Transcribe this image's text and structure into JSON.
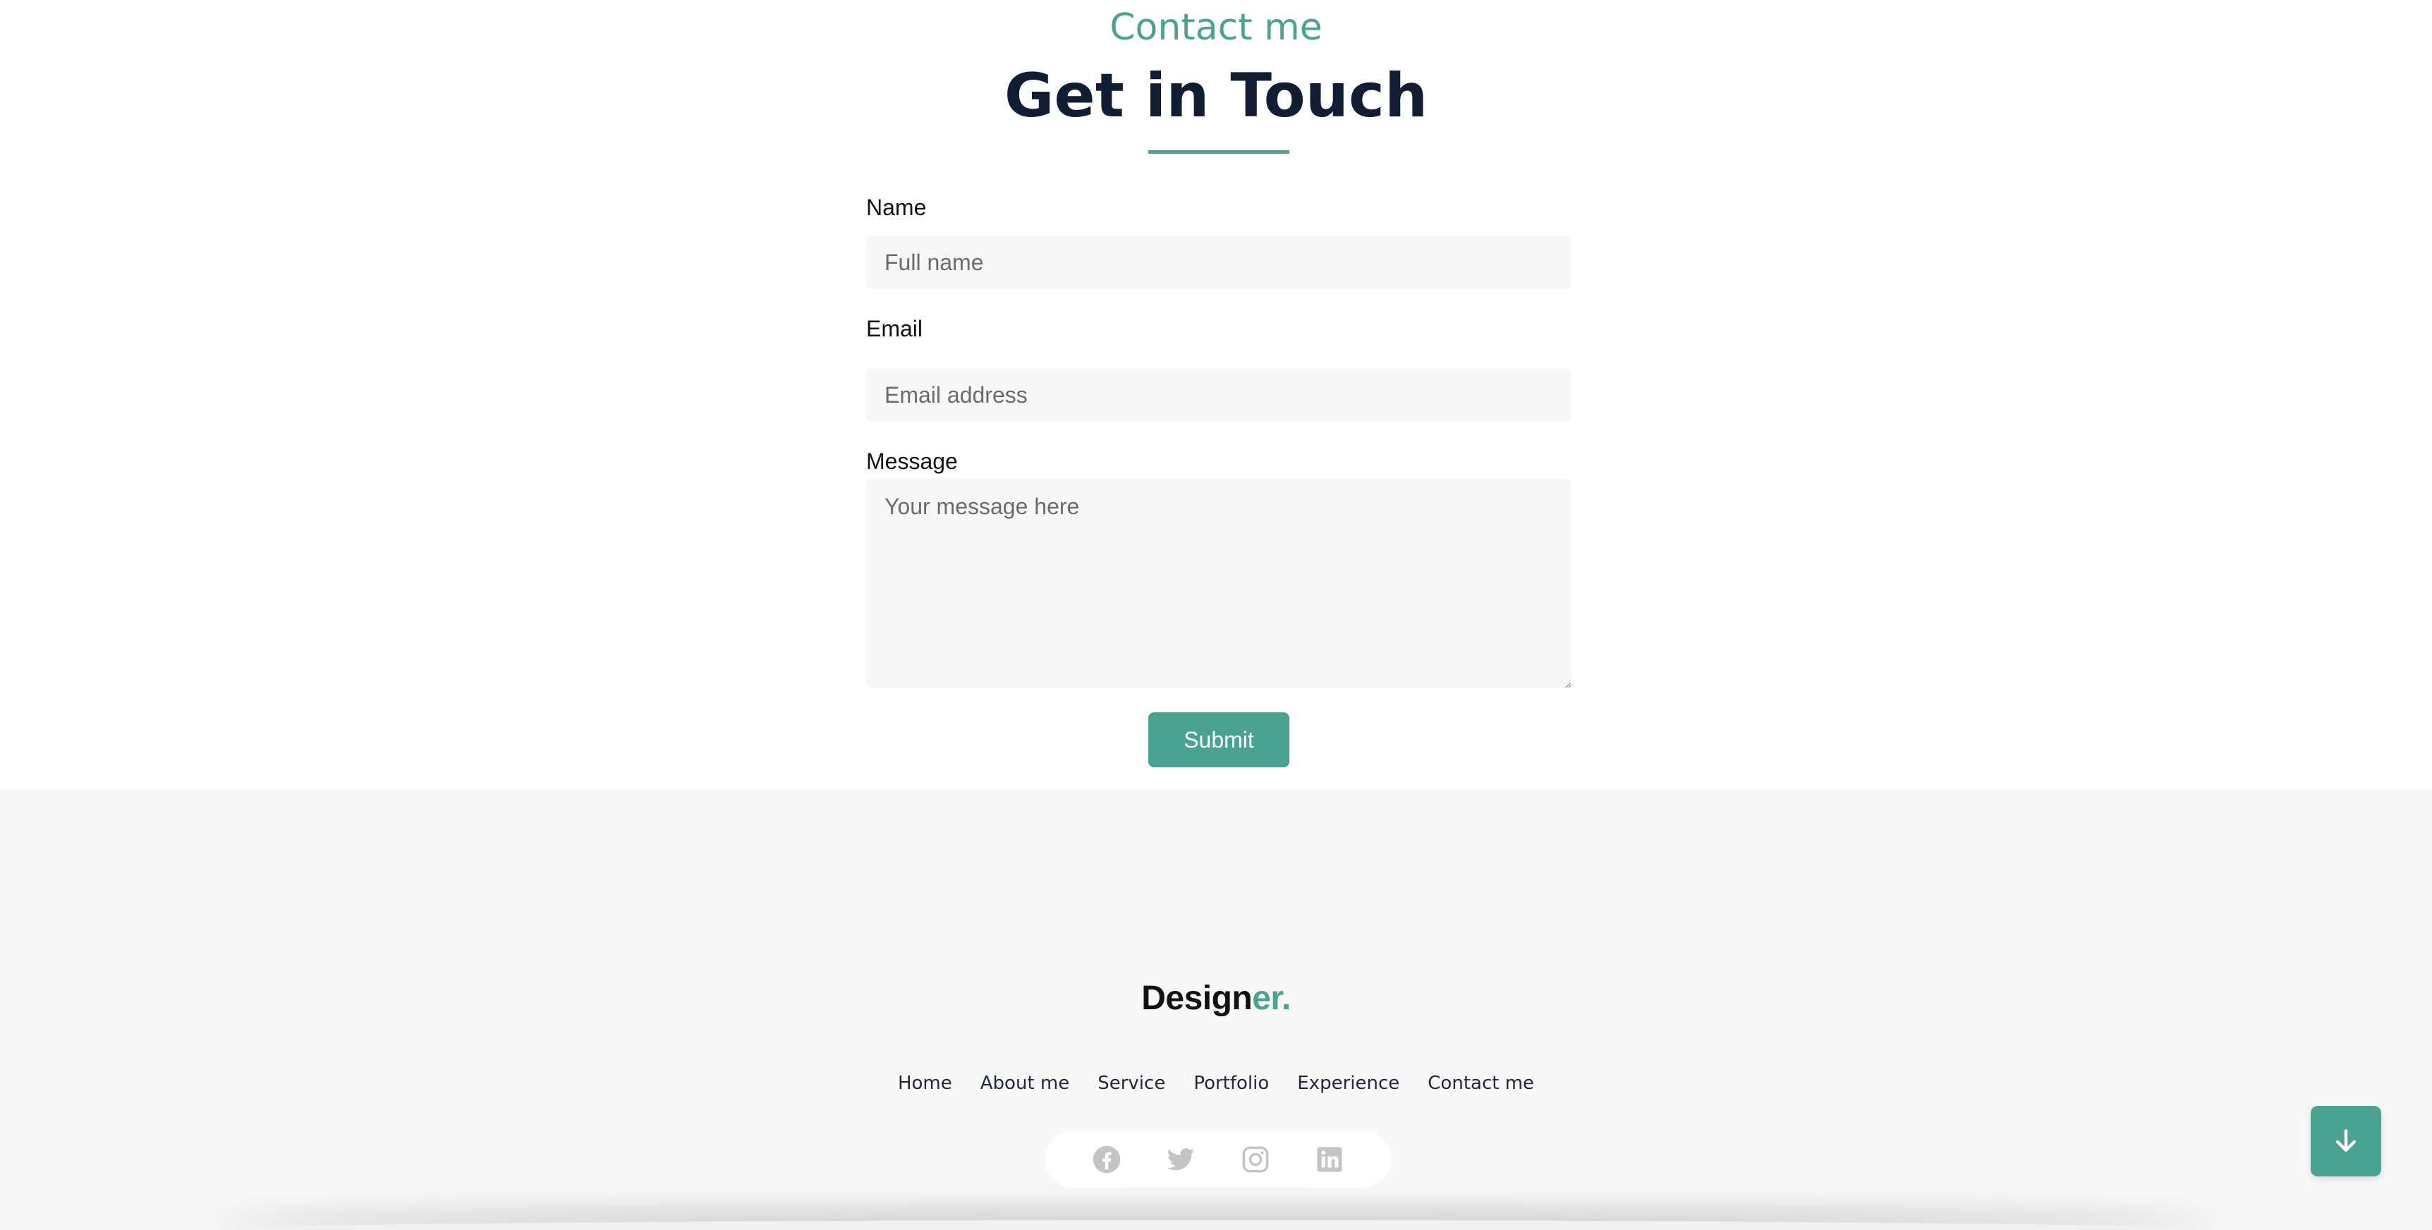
{
  "contact": {
    "eyebrow": "Contact me",
    "heading": "Get in Touch"
  },
  "form": {
    "name_label": "Name",
    "name_placeholder": "Full name",
    "email_label": "Email",
    "email_placeholder": "Email address",
    "message_label": "Message",
    "message_placeholder": "Your message here",
    "submit_label": "Submit"
  },
  "footer": {
    "logo_main": "Design",
    "logo_accent": "er.",
    "nav": [
      "Home",
      "About me",
      "Service",
      "Portfolio",
      "Experience",
      "Contact me"
    ],
    "social_icons": [
      "facebook-icon",
      "twitter-icon",
      "instagram-icon",
      "linkedin-icon"
    ]
  },
  "scroll_button_icon": "arrow-down-icon",
  "colors": {
    "accent": "#4aa391",
    "heading": "#111d33",
    "footer_bg": "#f8f8f8",
    "input_bg": "#f7f7f7",
    "social_icon": "#c4c4c4"
  }
}
